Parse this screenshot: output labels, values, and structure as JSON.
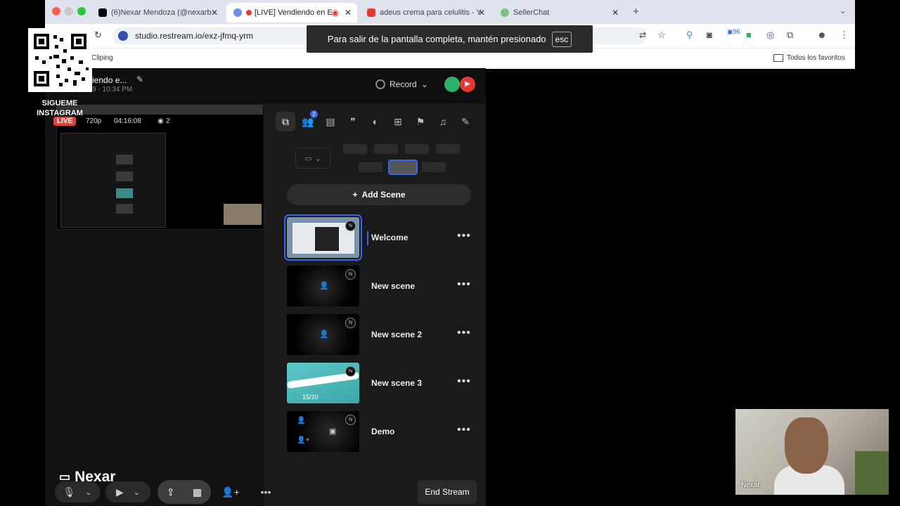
{
  "browser": {
    "tabs": [
      {
        "label": "(6)Nexar Mendoza (@nexarb",
        "color": "#000000"
      },
      {
        "label": "[LIVE] Vendiendo en E",
        "color": "#e53935"
      },
      {
        "label": "adeus crema para celulitis - Y",
        "color": "#e53935"
      },
      {
        "label": "SellerChat",
        "color": "#7bc47f"
      }
    ],
    "url": "studio.restream.io/exz-jfmq-yrm",
    "bookmark_left": "Cliping",
    "bookmark_right": "Todos los favoritos",
    "extension_count": "96"
  },
  "fullscreen_toast": {
    "message": "Para salir de la pantalla completa, mantén presionado",
    "key": "esc"
  },
  "overlay": {
    "follow_text": "SIGUEME INSTAGRAM"
  },
  "studio": {
    "stream_title": "iendo e...",
    "stream_time": "9 · 10:34 PM",
    "record_label": "Record",
    "preview": {
      "live_label": "LIVE",
      "resolution": "720p",
      "duration": "04:16:08",
      "viewers": "2"
    },
    "presenter_name": "Nexar",
    "toolbar_badge": "2",
    "add_scene_label": "Add Scene",
    "scenes": [
      {
        "name": "Welcome",
        "selected": true
      },
      {
        "name": "New scene",
        "selected": false
      },
      {
        "name": "New scene 2",
        "selected": false
      },
      {
        "name": "New scene 3",
        "selected": false,
        "slide_counter": "15/20"
      },
      {
        "name": "Demo",
        "selected": false
      }
    ],
    "end_stream_label": "End Stream"
  },
  "webcam": {
    "name_label": "Nexar"
  }
}
